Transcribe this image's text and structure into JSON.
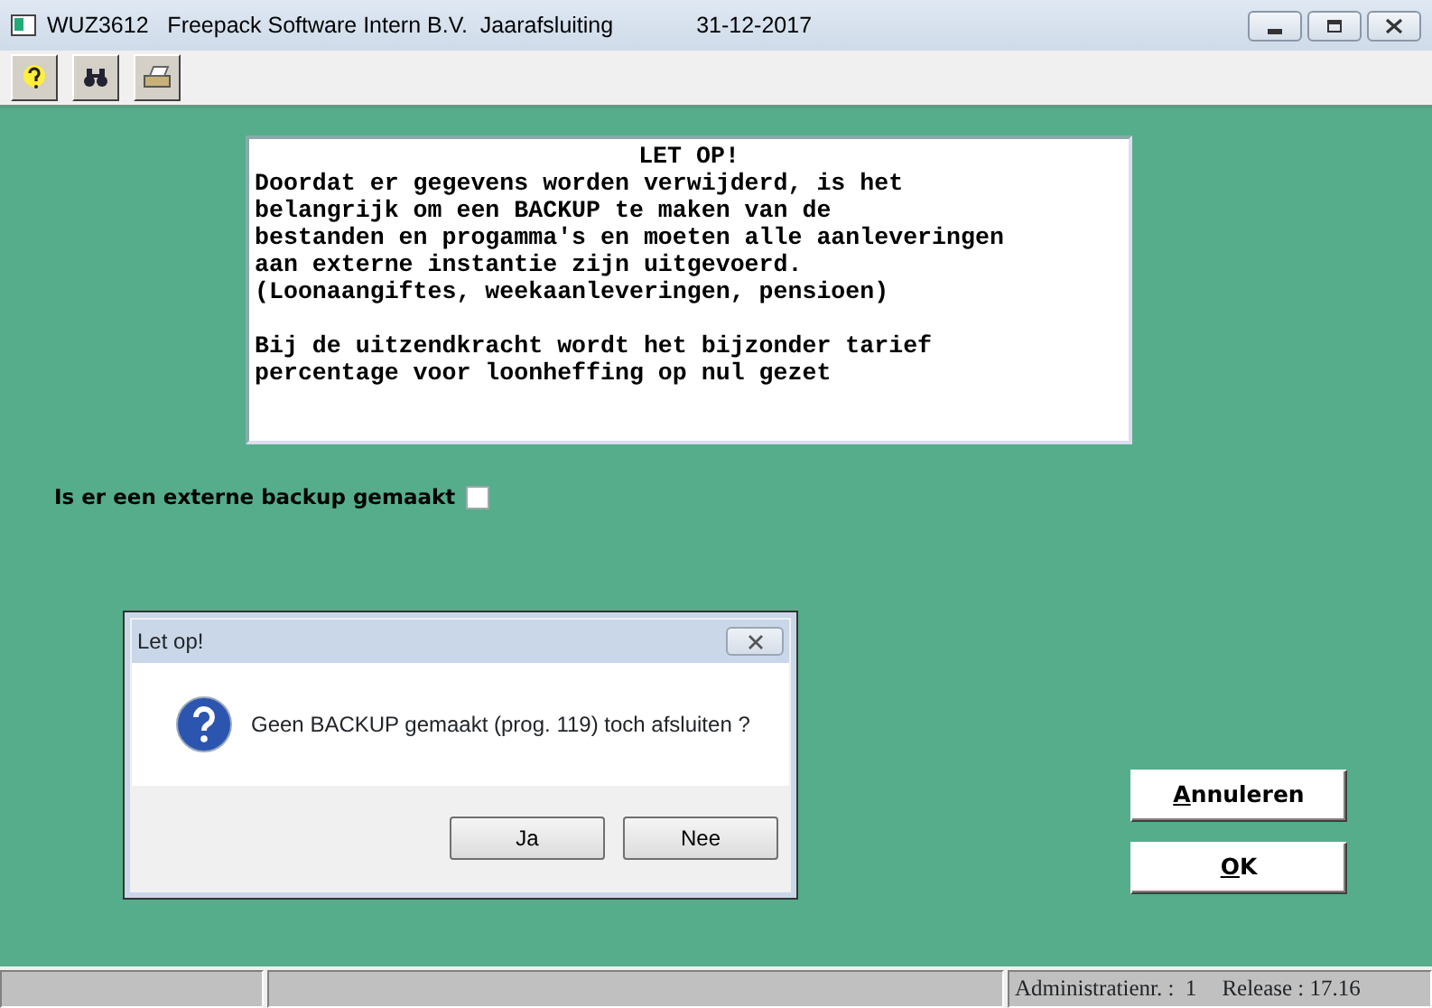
{
  "window": {
    "title": "WUZ3612   Freepack Software Intern B.V.  Jaarafsluiting",
    "date": "31-12-2017"
  },
  "toolbar": [
    {
      "kind": "help"
    },
    {
      "kind": "find"
    },
    {
      "kind": "print"
    }
  ],
  "notice": {
    "heading": "LET OP!",
    "paragraphs": [
      "Doordat er gegevens worden verwijderd, is het\nbelangrijk om een BACKUP te maken van de\nbestanden en progamma's en moeten alle aanleveringen\naan externe instantie zijn uitgevoerd.\n(Loonaangiftes, weekaanleveringen, pensioen)",
      "Bij de uitzendkracht wordt het bijzonder tarief\npercentage voor loonheffing op nul gezet"
    ]
  },
  "backup_question": {
    "label": "Is er een externe backup gemaakt",
    "checked": false
  },
  "buttons": [
    "Annuleren",
    "OK"
  ],
  "dialog": {
    "title": "Let op!",
    "message": "Geen BACKUP gemaakt (prog. 119) toch afsluiten ?",
    "buttons": [
      "Ja",
      "Nee"
    ]
  },
  "status_bar": {
    "administration_label": "Administratienr. :",
    "administration": "1",
    "release": "Release : 17.16"
  }
}
